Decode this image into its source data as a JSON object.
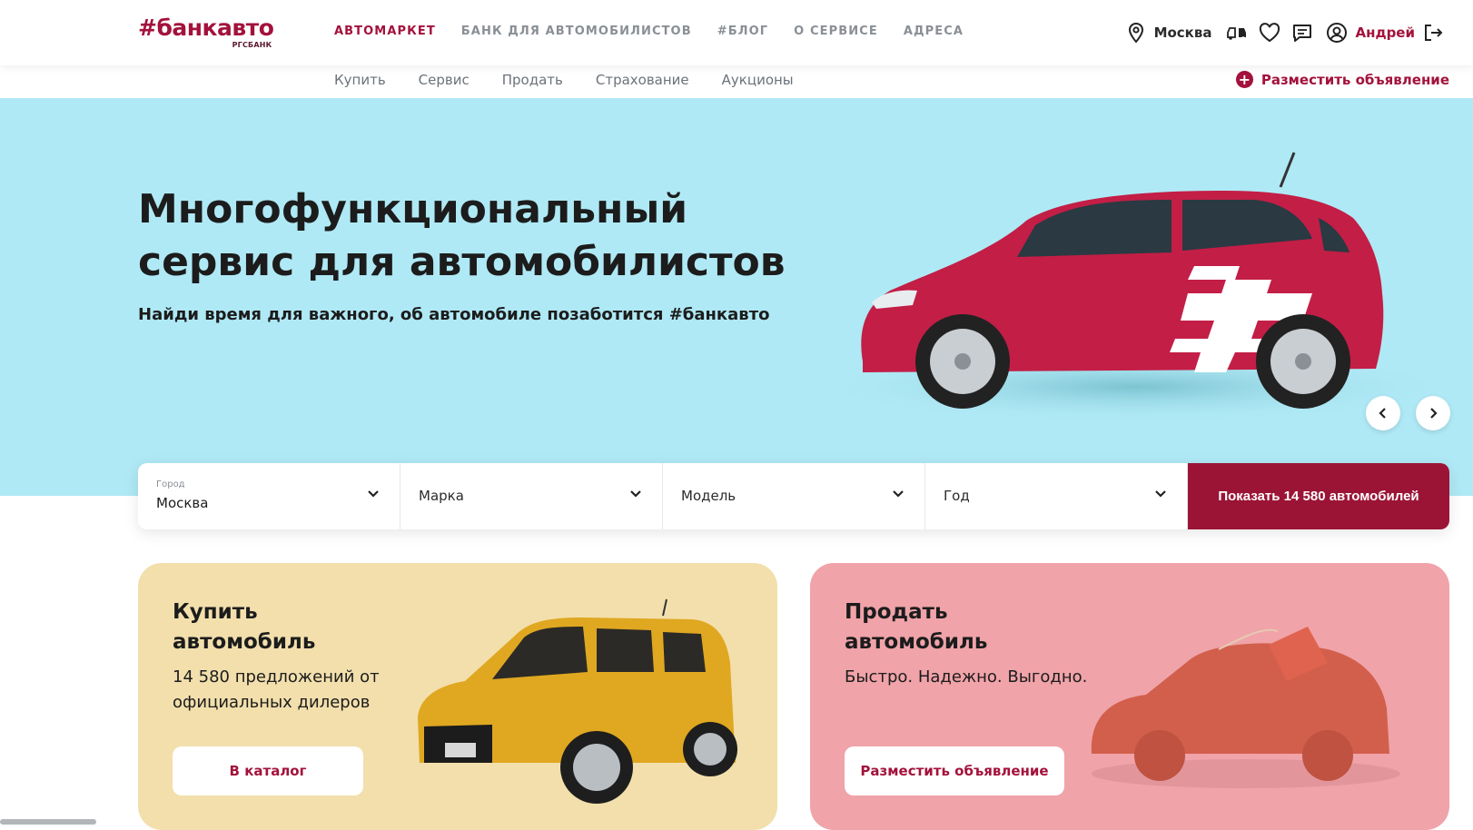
{
  "brand": {
    "logo": "#банкавто",
    "sub": "РГСБАНК"
  },
  "topnav": [
    {
      "label": "АВТОМАРКЕТ",
      "active": true
    },
    {
      "label": "БАНК ДЛЯ АВТОМОБИЛИСТОВ"
    },
    {
      "label": "#БЛОГ"
    },
    {
      "label": "О СЕРВИСЕ"
    },
    {
      "label": "АДРЕСА"
    }
  ],
  "header": {
    "city": "Москва",
    "user": "Андрей"
  },
  "subnav": {
    "links": [
      "Купить",
      "Сервис",
      "Продать",
      "Страхование",
      "Аукционы"
    ],
    "post_ad": "Разместить объявление"
  },
  "hero": {
    "title": "Многофункциональный сервис для автомобилистов",
    "subtitle": "Найди время для важного, об автомобиле позаботится #банкавто"
  },
  "search": {
    "city_caption": "Город",
    "city_value": "Москва",
    "brand_placeholder": "Марка",
    "model_placeholder": "Модель",
    "year_placeholder": "Год",
    "button": "Показать 14 580 автомобилей"
  },
  "cards": {
    "buy": {
      "title": "Купить автомобиль",
      "text": "14 580 предложений от официальных дилеров",
      "button": "В каталог"
    },
    "sell": {
      "title": "Продать автомобиль",
      "text": "Быстро. Надежно. Выгодно.",
      "button": "Разместить объявление"
    }
  },
  "colors": {
    "accent": "#a3123c",
    "hero_bg": "#afe9f5",
    "buy_card": "#f2dfac",
    "sell_card": "#f0a3a9"
  }
}
